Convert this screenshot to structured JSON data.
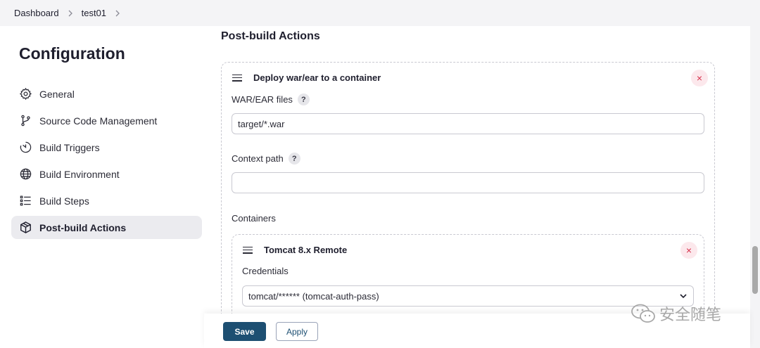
{
  "breadcrumb": {
    "items": [
      "Dashboard",
      "test01"
    ]
  },
  "sidebar": {
    "title": "Configuration",
    "items": [
      {
        "label": "General",
        "icon": "gear-icon"
      },
      {
        "label": "Source Code Management",
        "icon": "git-branch-icon"
      },
      {
        "label": "Build Triggers",
        "icon": "timer-icon"
      },
      {
        "label": "Build Environment",
        "icon": "globe-icon"
      },
      {
        "label": "Build Steps",
        "icon": "list-icon"
      },
      {
        "label": "Post-build Actions",
        "icon": "cube-icon",
        "active": true
      }
    ]
  },
  "main": {
    "section_title": "Post-build Actions",
    "deploy_card": {
      "title": "Deploy war/ear to a container",
      "war_label": "WAR/EAR files",
      "war_value": "target/*.war",
      "context_label": "Context path",
      "context_value": "",
      "containers_label": "Containers",
      "help_glyph": "?",
      "close_glyph": "×"
    },
    "container_card": {
      "title": "Tomcat 8.x Remote",
      "credentials_label": "Credentials",
      "credentials_value": "tomcat/****** (tomcat-auth-pass)"
    }
  },
  "actions": {
    "save_label": "Save",
    "apply_label": "Apply"
  },
  "watermark": {
    "text": "安全随笔"
  },
  "colors": {
    "primary": "#1d4f72",
    "close": "#d6304a",
    "active_bg": "#ebebef"
  }
}
